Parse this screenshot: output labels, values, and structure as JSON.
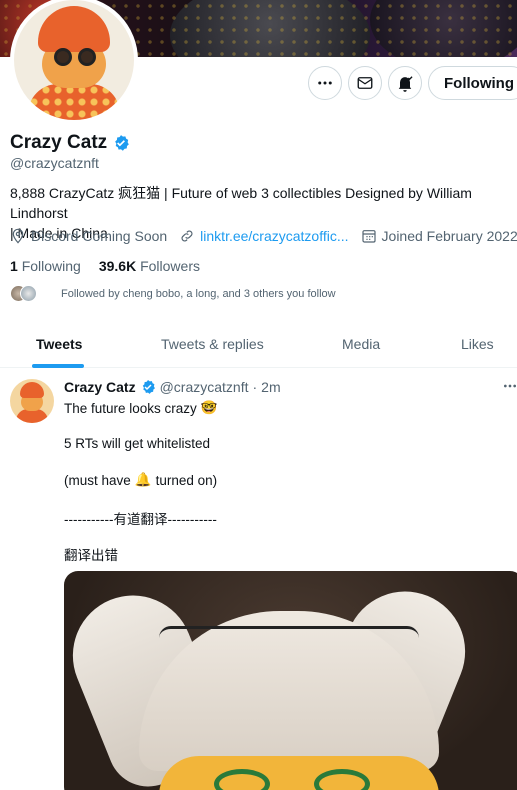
{
  "profile": {
    "name": "Crazy Catz",
    "handle": "@crazycatznft",
    "bio_line1": "8,888 CrazyCatz 疯狂猫 | Future of web 3 collectibles Designed by William Lindhorst",
    "bio_line2": "| Made in China",
    "location": "Discord Coming Soon",
    "link": "linktr.ee/crazycatzoffic...",
    "joined": "Joined February 2022",
    "following_count": "1",
    "following_label": "Following",
    "followers_count": "39.6K",
    "followers_label": "Followers",
    "followed_by": "Followed by cheng bobo, a long, and 3 others you follow",
    "follow_button_label": "Following"
  },
  "tabs": [
    "Tweets",
    "Tweets & replies",
    "Media",
    "Likes"
  ],
  "tweet": {
    "name": "Crazy Catz",
    "handle": "@crazycatznft",
    "dot": "·",
    "time": "2m",
    "line1": "The future looks crazy",
    "line1_emoji": "🤓",
    "line2": "5 RTs will get whitelisted",
    "line3_pre": "(must have",
    "line3_emoji": "🔔",
    "line3_post": "turned on)",
    "line4": "-----------有道翻译-----------",
    "line5": "翻译出错"
  },
  "colors": {
    "accent": "#1d9bf0",
    "text": "#0f1419",
    "muted": "#536471",
    "border": "#cfd9de"
  },
  "icons": [
    "more-icon",
    "mail-icon",
    "notification-icon",
    "verified-icon",
    "location-icon",
    "link-icon",
    "calendar-icon"
  ]
}
